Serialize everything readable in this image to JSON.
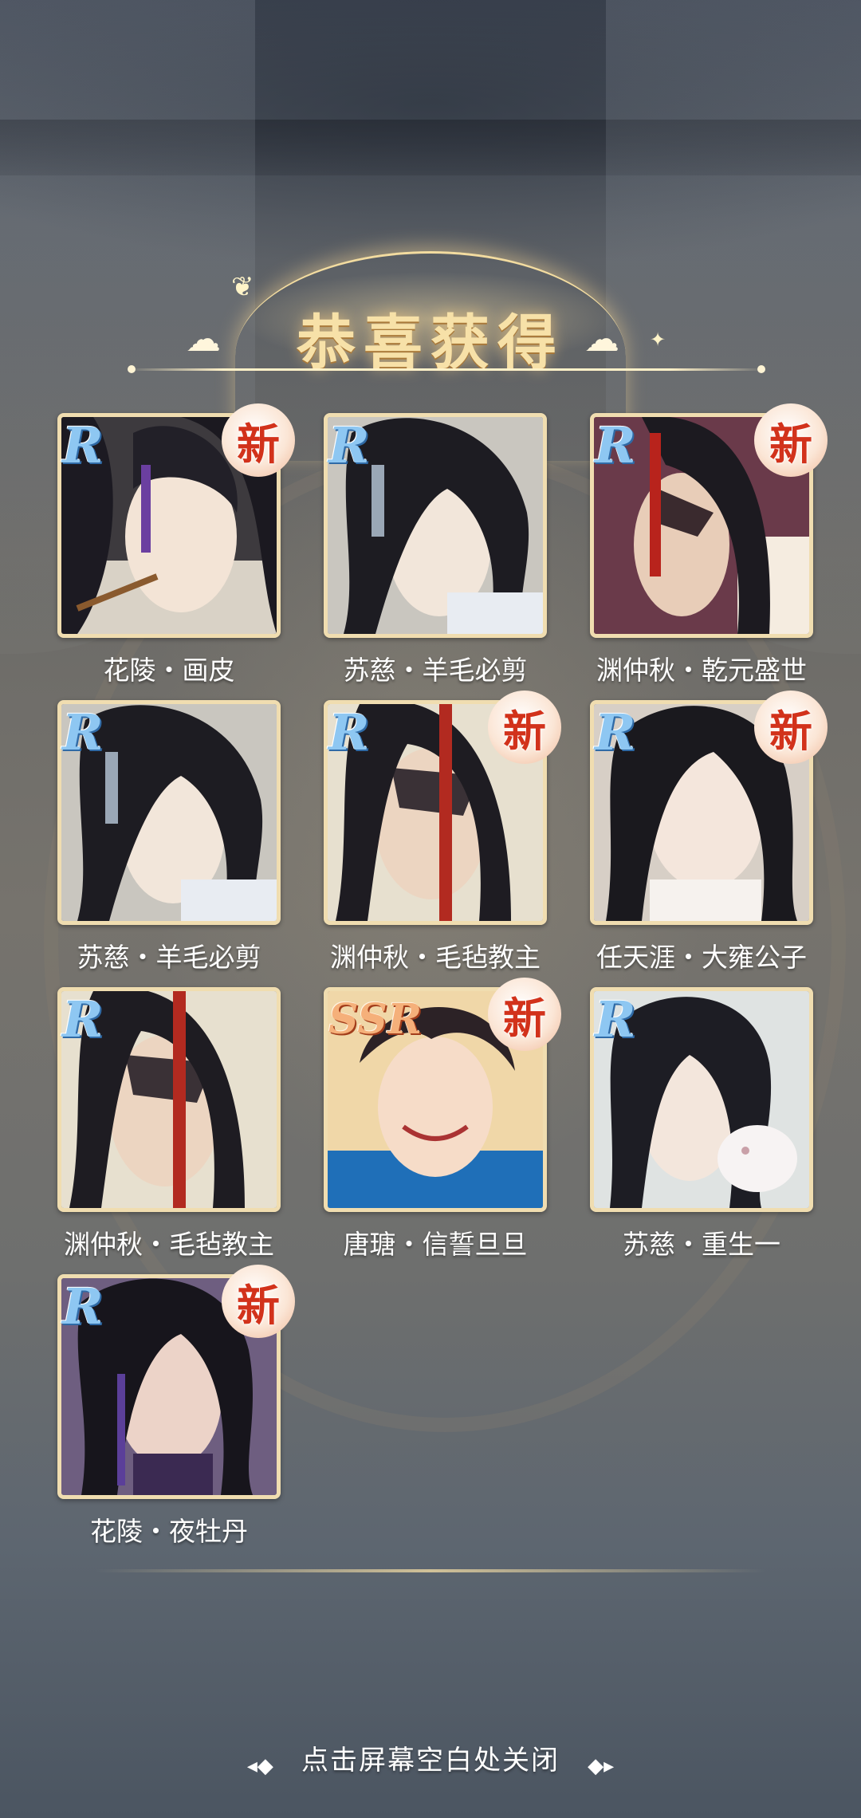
{
  "header": {
    "title": "恭喜获得"
  },
  "rewards": [
    {
      "rarity": "R",
      "is_new": true,
      "new_label": "新",
      "name": "花陵・画皮"
    },
    {
      "rarity": "R",
      "is_new": false,
      "new_label": "",
      "name": "苏慈・羊毛必剪"
    },
    {
      "rarity": "R",
      "is_new": true,
      "new_label": "新",
      "name": "渊仲秋・乾元盛世"
    },
    {
      "rarity": "R",
      "is_new": false,
      "new_label": "",
      "name": "苏慈・羊毛必剪"
    },
    {
      "rarity": "R",
      "is_new": true,
      "new_label": "新",
      "name": "渊仲秋・毛毡教主"
    },
    {
      "rarity": "R",
      "is_new": true,
      "new_label": "新",
      "name": "任天涯・大雍公子"
    },
    {
      "rarity": "R",
      "is_new": false,
      "new_label": "",
      "name": "渊仲秋・毛毡教主"
    },
    {
      "rarity": "SSR",
      "is_new": true,
      "new_label": "新",
      "name": "唐瑭・信誓旦旦"
    },
    {
      "rarity": "R",
      "is_new": false,
      "new_label": "",
      "name": "苏慈・重生一"
    },
    {
      "rarity": "R",
      "is_new": true,
      "new_label": "新",
      "name": "花陵・夜牡丹"
    }
  ],
  "footer": {
    "close_hint": "点击屏幕空白处关闭",
    "ornament_left": "◂◆",
    "ornament_right": "◆▸"
  },
  "colors": {
    "gold": "#f7e1a8",
    "new_red": "#d2321b",
    "r_blue": "#8ec7f2",
    "ssr_orange": "#f5b07a"
  }
}
